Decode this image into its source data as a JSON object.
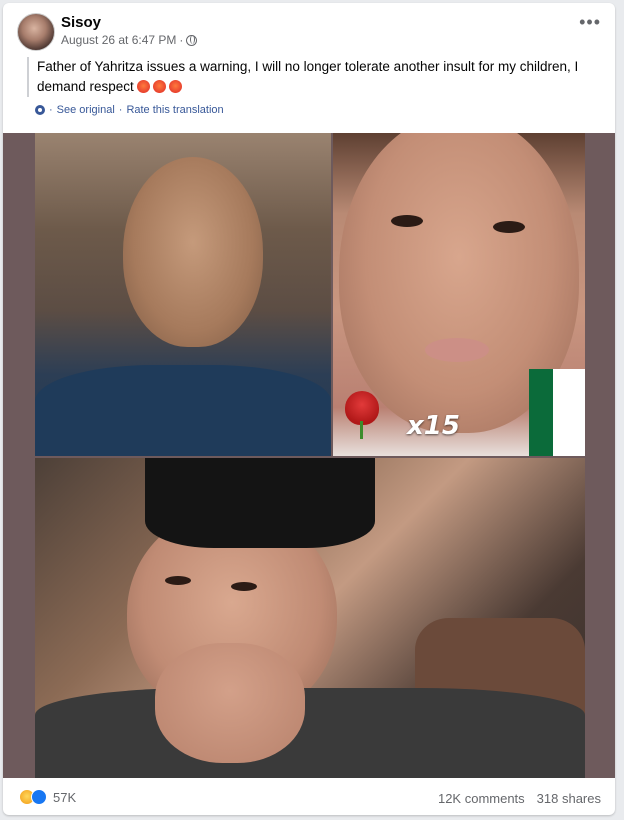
{
  "post": {
    "author": "Sisoy",
    "timestamp": "August 26 at 6:47 PM",
    "separator": "·",
    "privacy_icon": "globe-icon",
    "more_label": "•••",
    "text": "Father of Yahritza issues a warning, I will no longer tolerate another insult for my children, I demand respect",
    "see_original": "See original",
    "rate_translation": "Rate this translation",
    "translate_sep": "·"
  },
  "media": {
    "sticker_text": "x15"
  },
  "footer": {
    "reaction_count": "57K",
    "comments": "12K comments",
    "shares": "318 shares"
  },
  "colors": {
    "link": "#385898",
    "secondary": "#65676b",
    "media_bg": "#6e5a5c"
  }
}
